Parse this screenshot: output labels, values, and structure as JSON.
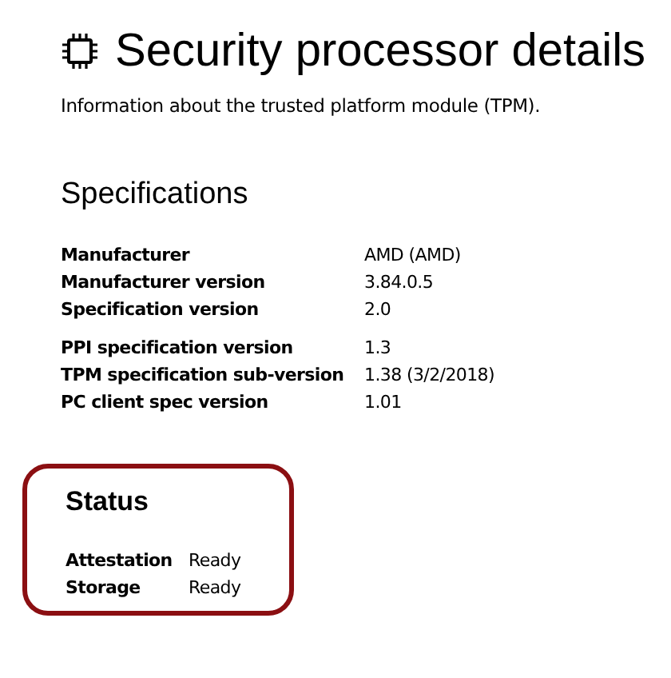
{
  "title": "Security processor details",
  "description": "Information about the trusted platform module (TPM).",
  "specifications": {
    "heading": "Specifications",
    "groups": [
      {
        "rows": [
          {
            "label": "Manufacturer",
            "value": "AMD (AMD)"
          },
          {
            "label": "Manufacturer version",
            "value": "3.84.0.5"
          },
          {
            "label": "Specification version",
            "value": "2.0"
          }
        ]
      },
      {
        "rows": [
          {
            "label": "PPI specification version",
            "value": "1.3"
          },
          {
            "label": "TPM specification sub-version",
            "value": "1.38 (3/2/2018)"
          },
          {
            "label": "PC client spec version",
            "value": "1.01"
          }
        ]
      }
    ]
  },
  "status": {
    "heading": "Status",
    "highlighted": true,
    "rows": [
      {
        "label": "Attestation",
        "value": "Ready"
      },
      {
        "label": "Storage",
        "value": "Ready"
      }
    ]
  }
}
